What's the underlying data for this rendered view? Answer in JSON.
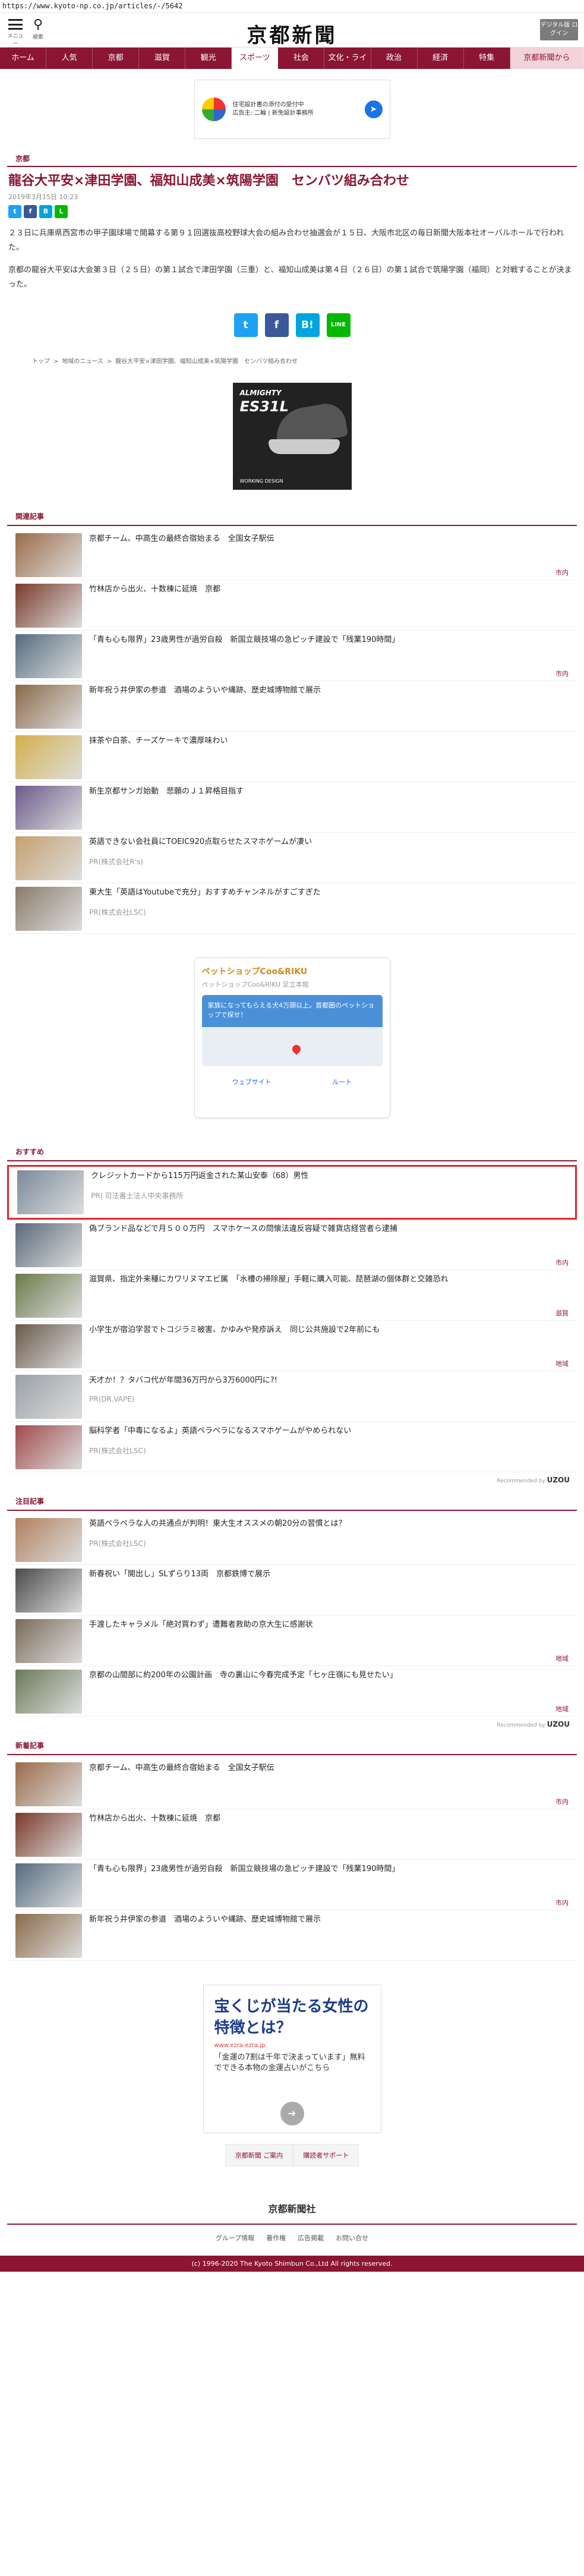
{
  "url": "https://www.kyoto-np.co.jp/articles/-/5642",
  "header": {
    "menu_caption": "メニュー",
    "search_caption": "検索",
    "logo": "京都新聞",
    "digital_button": "デジタル版 ログイン"
  },
  "nav": [
    "ホーム",
    "人気",
    "京都",
    "滋賀",
    "観光",
    "スポーツ",
    "社会",
    "文化・ライフ",
    "政治",
    "経済",
    "特集",
    "京都新聞から"
  ],
  "top_ad": {
    "line1": "住宅設計書の添付の受付中",
    "line2": "広告主: 二輪 | 新免設計事務所"
  },
  "article": {
    "section": "京都",
    "headline": "龍谷大平安×津田学園、福知山成美×筑陽学園　センバツ組み合わせ",
    "date": "2019年3月15日 10:23",
    "paragraph1": "２３日に兵庫県西宮市の甲子園球場で開幕する第９１回選抜高校野球大会の組み合わせ抽選会が１５日、大阪市北区の毎日新聞大阪本社オーバルホールで行われた。",
    "paragraph2": "京都の龍谷大平安は大会第３日（２５日）の第１試合で津田学園（三重）と、福知山成美は第４日（２６日）の第１試合で筑陽学園（福岡）と対戦することが決まった。"
  },
  "share_small": [
    "t",
    "f",
    "B",
    "L"
  ],
  "share_big": [
    "t",
    "f",
    "B!",
    "LINE"
  ],
  "breadcrumb": [
    "トップ",
    ">",
    "地域のニュース",
    ">",
    "龍谷大平安×津田学園、福知山成美×筑陽学園　センバツ組み合わせ"
  ],
  "shoe_ad": {
    "brand": "ALMIGHTY",
    "model": "ES31L",
    "tagline": "WORKING DESIGN"
  },
  "related": {
    "heading": "関連記事",
    "items": [
      {
        "title": "京都チーム、中高生の最終合宿始まる　全国女子駅伝",
        "cat": "市内",
        "color": "#9b6b4a"
      },
      {
        "title": "竹林店から出火、十数棟に延焼　京都",
        "cat": "",
        "color": "#7a3a2a"
      },
      {
        "title": "「青も心も限界」23歳男性が過労自殺　新国立競技場の急ピッチ建設で「残業190時間」",
        "cat": "市内",
        "color": "#556b80"
      },
      {
        "title": "新年祝う井伊家の参道　酒場のよういや縄跡、歴史城博物館で展示",
        "cat": "",
        "color": "#8b6a4a"
      },
      {
        "title": "抹茶や白茶、チーズケーキで濃厚味わい",
        "cat": "",
        "color": "#d4b04a"
      },
      {
        "title": "新生京都サンガ始動　悲願のＪ１昇格目指す",
        "cat": "",
        "color": "#6a5a8a"
      },
      {
        "title": "英語できない会社員にTOEIC920点取らせたスマホゲームが凄い",
        "pr": "PR(株式会社R's)",
        "color": "#c4a070"
      },
      {
        "title": "東大生「英語はYoutubeで充分」おすすめチャンネルがすごすぎた",
        "pr": "PR(株式会社LSC)",
        "color": "#8a7b6a"
      }
    ]
  },
  "shop_ad": {
    "name": "ペットショップCoo&RIKU",
    "address": "ペットショップCoo&RIKU 足立本館",
    "note": "家族になってもらえる犬4万頭以上。首都圏のペットショップで探せ！",
    "actions": [
      "ウェブサイト",
      "ルート"
    ]
  },
  "recommend": {
    "heading": "おすすめ",
    "items": [
      {
        "title": "クレジットカードから115万円返金された某山安泰（68）男性",
        "pr": "PR| 司法書士法人中央事務所",
        "color": "#7a8a9a",
        "highlight": true
      },
      {
        "title": "偽ブランド品などで月５００万円　スマホケースの問懐法違反容疑で雑貨店経営者ら逮捕",
        "cat": "市内",
        "color": "#5a6a7a"
      },
      {
        "title": "滋賀県、指定外来種にカワリヌマエビ属　「水槽の掃除屋」手軽に購入可能、琵琶湖の個体群と交雑恐れ",
        "cat": "滋賀",
        "color": "#6a7a4a"
      },
      {
        "title": "小学生が宿泊学習でトコジラミ被害、かゆみや発疹訴え　同じ公共施設で2年前にも",
        "cat": "地域",
        "color": "#6a5a4a"
      },
      {
        "title": "天才か！？タバコ代が年間36万円から3万6000円に?!",
        "pr": "PR(DR.VAPE)",
        "color": "#9aa0a6"
      },
      {
        "title": "脳科学者「中毒になるよ」英語ペラペラになるスマホゲームがやめられない",
        "pr": "PR(株式会社LSC)",
        "color": "#a04a4a"
      }
    ],
    "recommended_by": "Recommended by",
    "recommended_brand": "UZOU"
  },
  "attention": {
    "heading": "注目記事",
    "items": [
      {
        "title": "英語ペラペラな人の共通点が判明！東大生オススメの朝20分の習慣とは？",
        "pr": "PR(株式会社LSC)",
        "color": "#b08060"
      },
      {
        "title": "新春祝い「開出し」SLずらり13両　京都鉄博で展示",
        "cat": "",
        "color": "#4a4a4a"
      },
      {
        "title": "手渡したキャラメル「絶対買わず」遭難者救助の京大生に感謝状",
        "cat": "地域",
        "color": "#7a6a5a"
      },
      {
        "title": "京都の山間部に約200年の公園計画　寺の裏山に今春完成予定「七ヶ庄嶺にも見せたい」",
        "cat": "地域",
        "color": "#6a7a5a"
      }
    ]
  },
  "latest": {
    "heading": "新着記事",
    "items": [
      {
        "title": "京都チーム、中高生の最終合宿始まる　全国女子駅伝",
        "cat": "市内",
        "color": "#9b6b4a"
      },
      {
        "title": "竹林店から出火、十数棟に延焼　京都",
        "cat": "",
        "color": "#7a3a2a"
      },
      {
        "title": "「青も心も限界」23歳男性が過労自殺　新国立競技場の急ピッチ建設で「残業190時間」",
        "cat": "市内",
        "color": "#556b80"
      },
      {
        "title": "新年祝う井伊家の参道　酒場のよういや縄跡、歴史城博物館で展示",
        "cat": "",
        "color": "#8b6a4a"
      }
    ]
  },
  "lottery_ad": {
    "title": "宝くじが当たる女性の特徴とは？",
    "url": "www.ezra-ezra.jp",
    "desc": "「金運の7割は千年で決まっています」無料でできる本物の金運占いがこちら"
  },
  "footer": {
    "links": [
      "京都新聞 ご案内",
      "購読者サポート"
    ],
    "logo": "京都新聞社",
    "nav": [
      "グループ情報",
      "著作権",
      "広告掲載",
      "お問い合せ"
    ],
    "copyright": "(c) 1996-2020 The Kyoto Shimbun Co.,Ltd All rights reserved."
  }
}
